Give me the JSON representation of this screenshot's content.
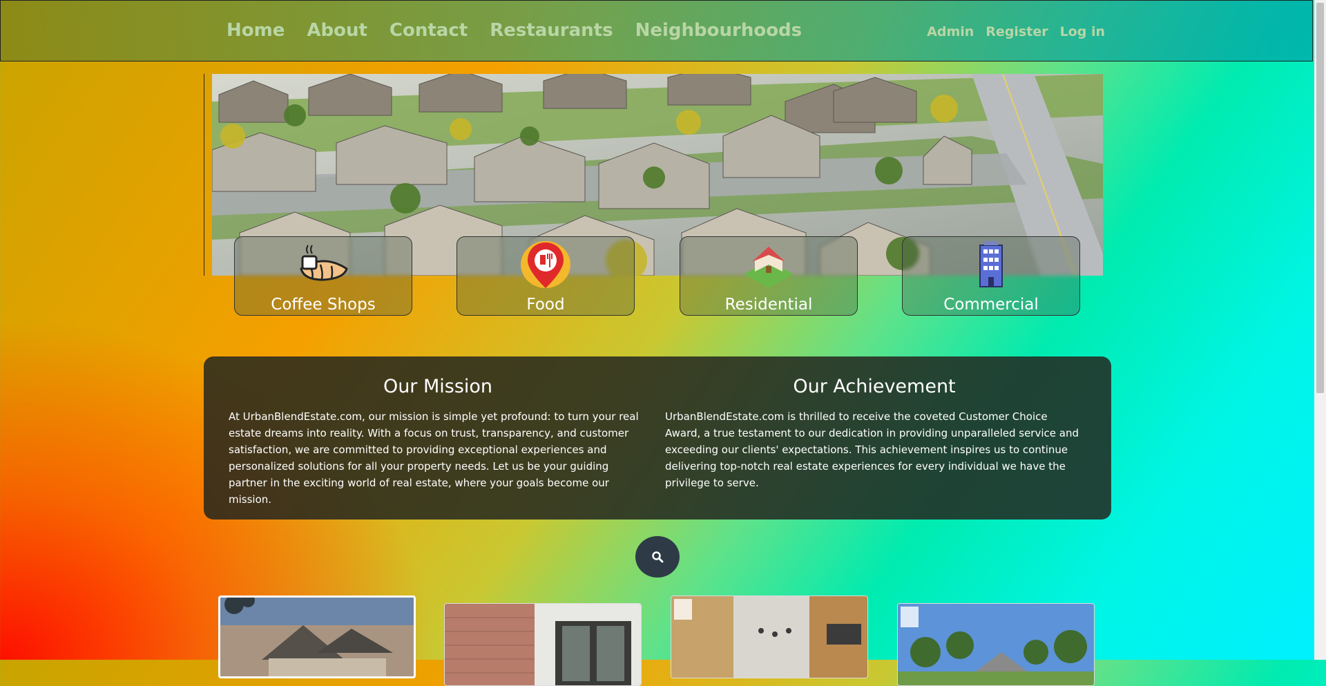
{
  "navbar": {
    "links": [
      "Home",
      "About",
      "Contact",
      "Restaurants",
      "Neighbourhoods"
    ],
    "account_links": [
      "Admin",
      "Register",
      "Log in"
    ]
  },
  "categories": [
    {
      "label": "Coffee Shops",
      "icon": "coffee-croissant-icon"
    },
    {
      "label": "Food",
      "icon": "food-location-pin-icon"
    },
    {
      "label": "Residential",
      "icon": "house-icon"
    },
    {
      "label": "Commercial",
      "icon": "building-icon"
    }
  ],
  "mission": {
    "title": "Our Mission",
    "text": "At UrbanBlendEstate.com, our mission is simple yet profound: to turn your real estate dreams into reality. With a focus on trust, transparency, and customer satisfaction, we are committed to providing exceptional experiences and personalized solutions for all your property needs. Let us be your guiding partner in the exciting world of real estate, where your goals become our mission."
  },
  "achievement": {
    "title": "Our Achievement",
    "text": "UrbanBlendEstate.com is thrilled to receive the coveted Customer Choice Award, a true testament to our dedication in providing unparalleled service and exceeding our clients' expectations. This achievement inspires us to continue delivering top-notch real estate experiences for every individual we have the privilege to serve."
  },
  "search": {
    "icon": "search-icon"
  },
  "colors": {
    "panel": "#23261e",
    "search_button": "#2e3b46",
    "nav_text": "#b9d6a6"
  }
}
